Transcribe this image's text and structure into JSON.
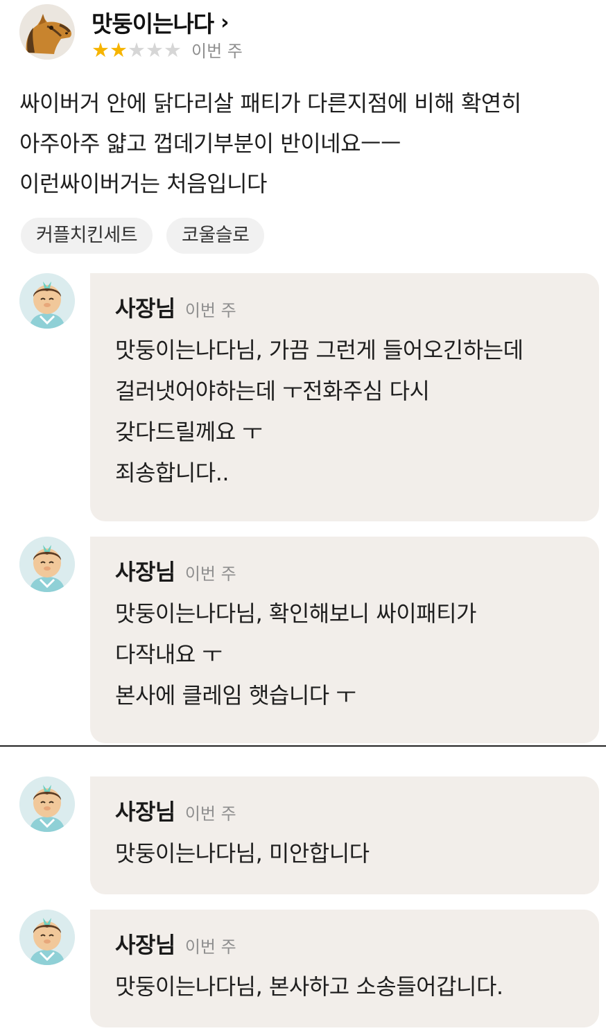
{
  "review": {
    "reviewer_name": "맛둥이는나다",
    "chevron": "›",
    "rating": 2,
    "rating_max": 5,
    "time": "이번 주",
    "lines": [
      "싸이버거 안에 닭다리살 패티가 다른지점에 비해 확연히",
      "아주아주 얇고 껍데기부분이 반이네요ㅡㅡ",
      "이런싸이버거는 처음입니다"
    ],
    "tags": [
      "커플치킨세트",
      "코울슬로"
    ]
  },
  "replies": [
    {
      "owner": "사장님",
      "time": "이번 주",
      "lines": [
        "맛둥이는나다님, 가끔 그런게 들어오긴하는데",
        "걸러냇어야하는데 ㅜ전화주심 다시",
        "갖다드릴께요 ㅜ",
        "죄송합니다.."
      ]
    },
    {
      "owner": "사장님",
      "time": "이번 주",
      "lines": [
        "맛둥이는나다님, 확인해보니 싸이패티가",
        "다작내요 ㅜ",
        "본사에 클레임 햇습니다 ㅜ"
      ]
    },
    {
      "owner": "사장님",
      "time": "이번 주",
      "lines": [
        "맛둥이는나다님, 미안합니다"
      ]
    },
    {
      "owner": "사장님",
      "time": "이번 주",
      "lines": [
        "맛둥이는나다님, 본사하고 소송들어갑니다."
      ]
    }
  ],
  "colors": {
    "star_on": "#f6b400",
    "star_off": "#d6d6d6",
    "bubble_bg": "#f2eeea",
    "muted_text": "#8e8e8e"
  },
  "icons": {
    "reviewer_avatar": "horse-avatar-icon",
    "owner_avatar": "chef-avatar-icon",
    "star": "star-icon",
    "chevron": "chevron-right-icon"
  }
}
